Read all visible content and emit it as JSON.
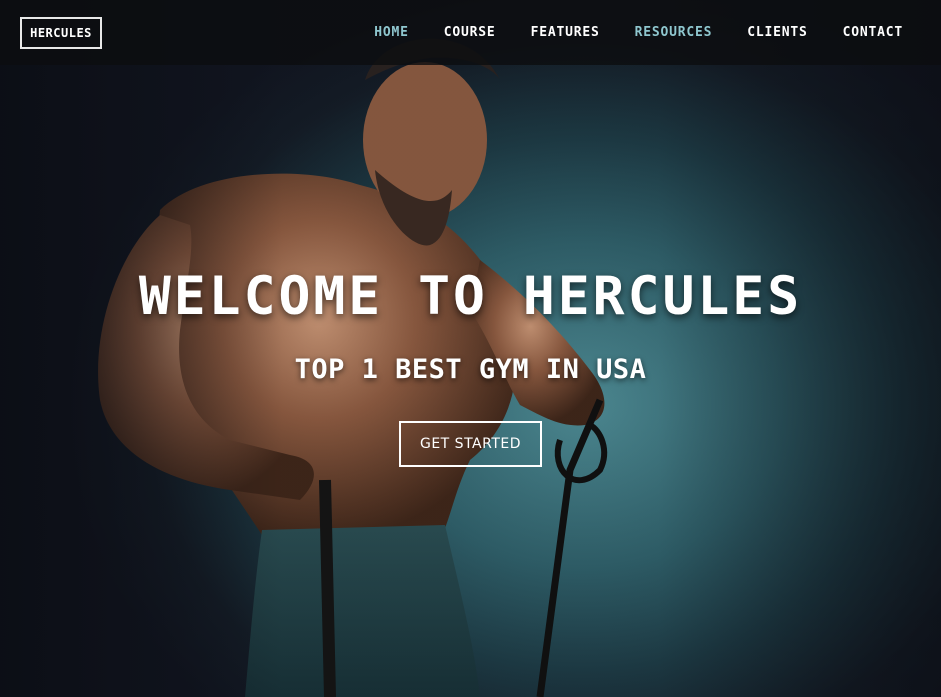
{
  "brand": {
    "logo_text": "HERCULES"
  },
  "nav": {
    "items": [
      {
        "label": "HOME",
        "accent": true
      },
      {
        "label": "COURSE",
        "accent": false
      },
      {
        "label": "FEATURES",
        "accent": false
      },
      {
        "label": "RESOURCES",
        "accent": true
      },
      {
        "label": "CLIENTS",
        "accent": false
      },
      {
        "label": "CONTACT",
        "accent": false
      }
    ]
  },
  "hero": {
    "title": "WELCOME TO HERCULES",
    "subtitle": "TOP 1 BEST GYM IN USA",
    "cta_label": "GET STARTED",
    "image": "muscular-athlete-with-resistance-band-photo"
  },
  "colors": {
    "nav_bg": "#0c0e10",
    "nav_accent": "#8fc7cf",
    "text": "#ffffff",
    "backdrop": "#2f5f69"
  }
}
